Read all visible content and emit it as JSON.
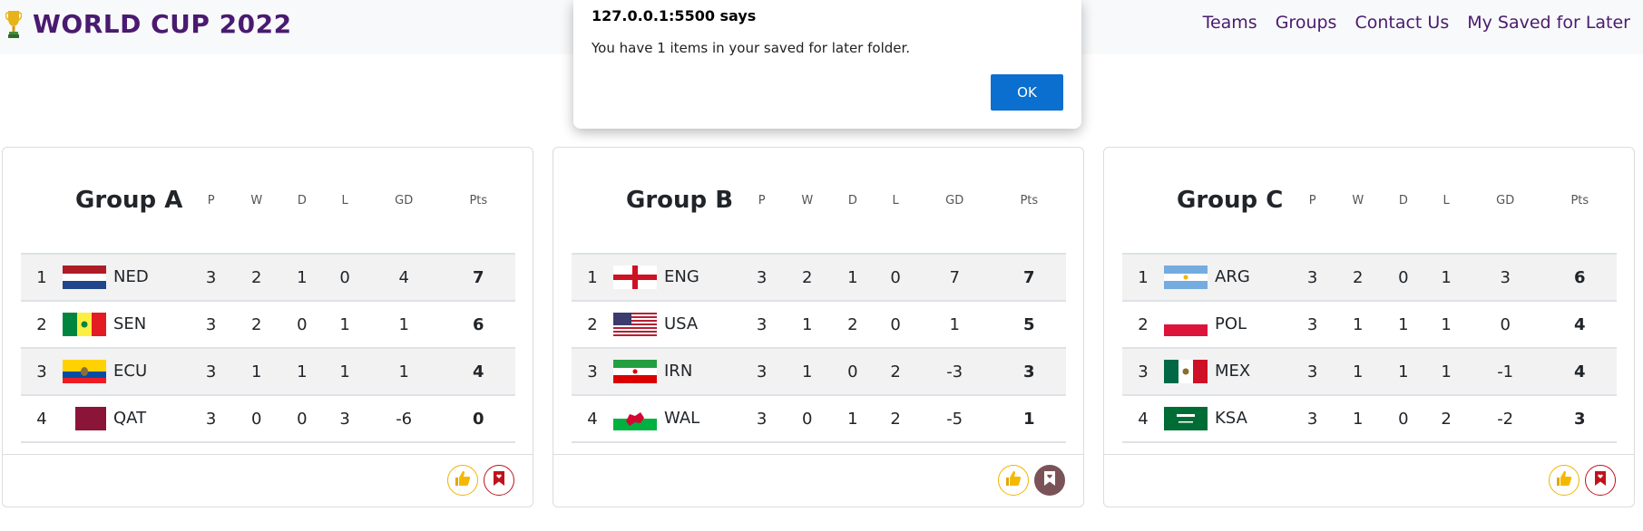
{
  "navbar": {
    "brand": "WORLD CUP 2022",
    "links": [
      "Teams",
      "Groups",
      "Contact Us",
      "My Saved for Later"
    ]
  },
  "columns": [
    "P",
    "W",
    "D",
    "L",
    "GD",
    "Pts"
  ],
  "groups": [
    {
      "name": "Group A",
      "saved": false,
      "rows": [
        {
          "pos": "1",
          "flag": "NED",
          "team": "NED",
          "p": "3",
          "w": "2",
          "d": "1",
          "l": "0",
          "gd": "4",
          "pts": "7"
        },
        {
          "pos": "2",
          "flag": "SEN",
          "team": "SEN",
          "p": "3",
          "w": "2",
          "d": "0",
          "l": "1",
          "gd": "1",
          "pts": "6"
        },
        {
          "pos": "3",
          "flag": "ECU",
          "team": "ECU",
          "p": "3",
          "w": "1",
          "d": "1",
          "l": "1",
          "gd": "1",
          "pts": "4"
        },
        {
          "pos": "4",
          "flag": "QAT",
          "team": "QAT",
          "p": "3",
          "w": "0",
          "d": "0",
          "l": "3",
          "gd": "-6",
          "pts": "0"
        }
      ]
    },
    {
      "name": "Group B",
      "saved": true,
      "rows": [
        {
          "pos": "1",
          "flag": "ENG",
          "team": "ENG",
          "p": "3",
          "w": "2",
          "d": "1",
          "l": "0",
          "gd": "7",
          "pts": "7"
        },
        {
          "pos": "2",
          "flag": "USA",
          "team": "USA",
          "p": "3",
          "w": "1",
          "d": "2",
          "l": "0",
          "gd": "1",
          "pts": "5"
        },
        {
          "pos": "3",
          "flag": "IRN",
          "team": "IRN",
          "p": "3",
          "w": "1",
          "d": "0",
          "l": "2",
          "gd": "-3",
          "pts": "3"
        },
        {
          "pos": "4",
          "flag": "WAL",
          "team": "WAL",
          "p": "3",
          "w": "0",
          "d": "1",
          "l": "2",
          "gd": "-5",
          "pts": "1"
        }
      ]
    },
    {
      "name": "Group C",
      "saved": false,
      "rows": [
        {
          "pos": "1",
          "flag": "ARG",
          "team": "ARG",
          "p": "3",
          "w": "2",
          "d": "0",
          "l": "1",
          "gd": "3",
          "pts": "6"
        },
        {
          "pos": "2",
          "flag": "POL",
          "team": "POL",
          "p": "3",
          "w": "1",
          "d": "1",
          "l": "1",
          "gd": "0",
          "pts": "4"
        },
        {
          "pos": "3",
          "flag": "MEX",
          "team": "MEX",
          "p": "3",
          "w": "1",
          "d": "1",
          "l": "1",
          "gd": "-1",
          "pts": "4"
        },
        {
          "pos": "4",
          "flag": "KSA",
          "team": "KSA",
          "p": "3",
          "w": "1",
          "d": "0",
          "l": "2",
          "gd": "-2",
          "pts": "3"
        }
      ]
    }
  ],
  "icons": {
    "like": "thumbs-up-icon",
    "save": "bookmark-heart-icon",
    "brand": "trophy-icon"
  },
  "colors": {
    "brand": "#4a1a70",
    "like_border": "#f0b400",
    "save_border": "#c0121b",
    "saved_fill": "#7a5358",
    "ok_button": "#0b6fd0"
  },
  "dialog": {
    "origin": "127.0.0.1:5500 says",
    "message": "You have 1 items in your saved for later folder.",
    "ok_label": "OK"
  }
}
